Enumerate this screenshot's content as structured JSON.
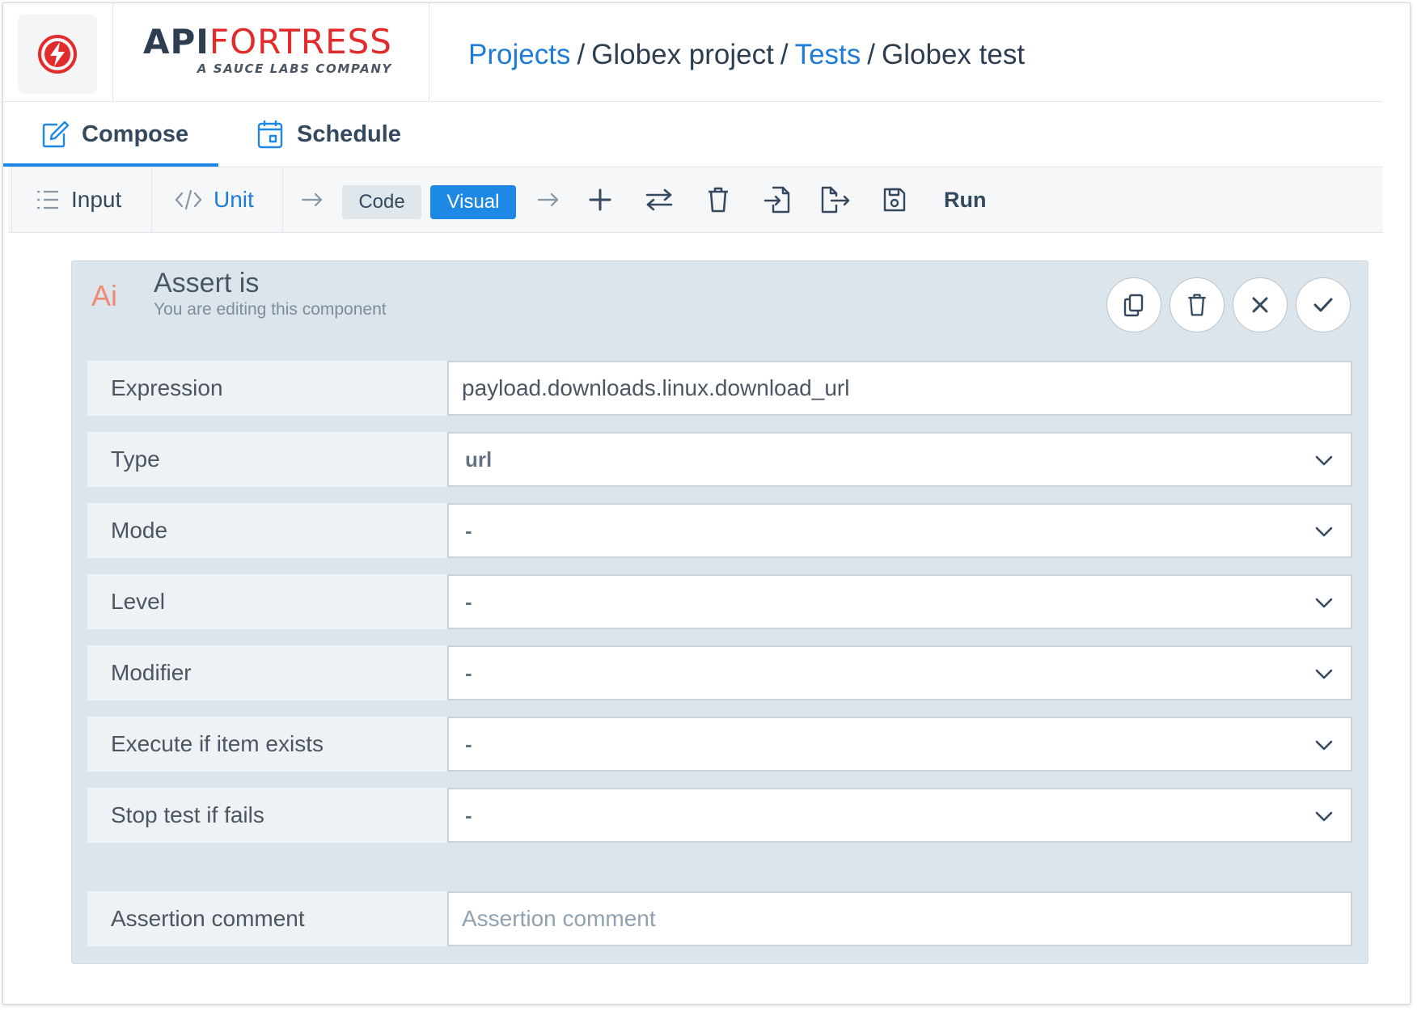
{
  "brand": {
    "name_part1": "API",
    "name_part2": "FORTRESS",
    "tagline": "A SAUCE LABS COMPANY"
  },
  "breadcrumb": {
    "items": [
      {
        "label": "Projects",
        "link": true
      },
      {
        "label": "Globex project",
        "link": false
      },
      {
        "label": "Tests",
        "link": true
      },
      {
        "label": "Globex test",
        "link": false
      }
    ],
    "separator": "/"
  },
  "tabs": [
    {
      "label": "Compose",
      "active": true,
      "icon": "edit-icon"
    },
    {
      "label": "Schedule",
      "active": false,
      "icon": "calendar-icon"
    }
  ],
  "toolbar": {
    "input_label": "Input",
    "unit_label": "Unit",
    "code_label": "Code",
    "visual_label": "Visual",
    "run_label": "Run",
    "active_mode": "Visual"
  },
  "component": {
    "icon_text": "Ai",
    "title": "Assert is",
    "subtitle": "You are editing this component",
    "actions": [
      "copy-icon",
      "trash-icon",
      "close-icon",
      "check-icon"
    ]
  },
  "fields": [
    {
      "label": "Expression",
      "value": "payload.downloads.linux.download_url",
      "kind": "text"
    },
    {
      "label": "Type",
      "value": "url",
      "kind": "select"
    },
    {
      "label": "Mode",
      "value": "-",
      "kind": "select"
    },
    {
      "label": "Level",
      "value": "-",
      "kind": "select"
    },
    {
      "label": "Modifier",
      "value": "-",
      "kind": "select"
    },
    {
      "label": "Execute if item exists",
      "value": "-",
      "kind": "select"
    },
    {
      "label": "Stop test if fails",
      "value": "-",
      "kind": "select"
    }
  ],
  "comment": {
    "label": "Assertion comment",
    "placeholder": "Assertion comment",
    "value": ""
  },
  "colors": {
    "accent": "#1e88e5",
    "link": "#1e7bd8",
    "brand_red": "#e22b2b",
    "panel_bg": "#dce5eb"
  }
}
